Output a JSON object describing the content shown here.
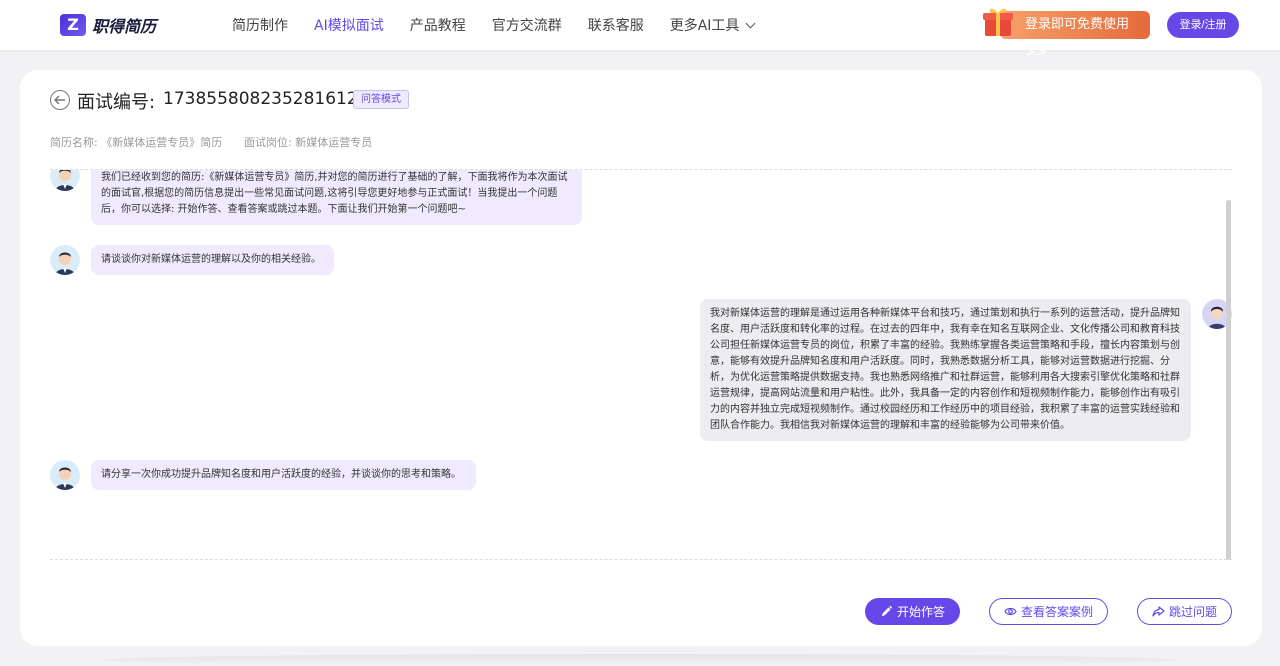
{
  "header": {
    "logo_mark": "Z",
    "logo_text": "职得简历",
    "nav": [
      {
        "label": "简历制作"
      },
      {
        "label": "AI模拟面试"
      },
      {
        "label": "产品教程"
      },
      {
        "label": "官方交流群"
      },
      {
        "label": "联系客服"
      },
      {
        "label": "更多AI工具"
      }
    ],
    "promo_label": "登录即可免费使用 >>",
    "login_label": "登录/注册"
  },
  "interview": {
    "title_label": "面试编号:",
    "title_id": "1738558082352816128",
    "mode_badge": "问答模式",
    "resume_name": "简历名称: 《新媒体运营专员》简历",
    "position": "面试岗位: 新媒体运营专员"
  },
  "messages": [
    {
      "role": "ai",
      "text": "我们已经收到您的简历:《新媒体运营专员》简历,并对您的简历进行了基础的了解，下面我将作为本次面试的面试官,根据您的简历信息提出一些常见面试问题,这将引导您更好地参与正式面试！当我提出一个问题后，你可以选择: 开始作答、查看答案或跳过本题。下面让我们开始第一个问题吧~"
    },
    {
      "role": "ai",
      "text": "请谈谈你对新媒体运营的理解以及你的相关经验。"
    },
    {
      "role": "user",
      "text": "我对新媒体运营的理解是通过运用各种新媒体平台和技巧，通过策划和执行一系列的运营活动，提升品牌知名度、用户活跃度和转化率的过程。在过去的四年中，我有幸在知名互联网企业、文化传播公司和教育科技公司担任新媒体运营专员的岗位，积累了丰富的经验。我熟练掌握各类运营策略和手段，擅长内容策划与创意，能够有效提升品牌知名度和用户活跃度。同时，我熟悉数据分析工具，能够对运营数据进行挖掘、分析，为优化运营策略提供数据支持。我也熟悉网络推广和社群运营，能够利用各大搜索引擎优化策略和社群运营规律，提高网站流量和用户粘性。此外，我具备一定的内容创作和短视频制作能力，能够创作出有吸引力的内容并独立完成短视频制作。通过校园经历和工作经历中的项目经验，我积累了丰富的运营实践经验和团队合作能力。我相信我对新媒体运营的理解和丰富的经验能够为公司带来价值。"
    },
    {
      "role": "ai",
      "text": "请分享一次你成功提升品牌知名度和用户活跃度的经验，并谈谈你的思考和策略。"
    }
  ],
  "actions": {
    "start_label": "开始作答",
    "view_label": "查看答案案例",
    "skip_label": "跳过问题"
  },
  "colors": {
    "accent": "#6648e8",
    "ai_bubble": "#efeafd",
    "user_bubble": "#ececf1",
    "promo": "#e56a3a"
  }
}
